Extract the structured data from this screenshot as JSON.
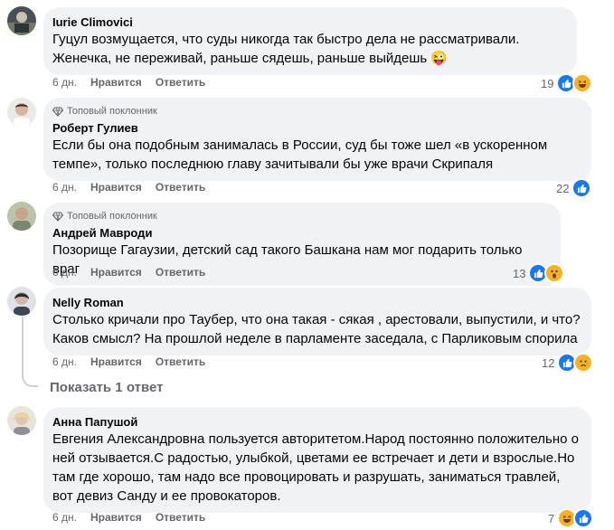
{
  "comments": [
    {
      "author": "Iurie Climovici",
      "badge": "",
      "text": "Гуцул возмущается, что суды никогда так быстро дела не рассматривали. Женечка, не переживай, раньше сядешь, раньше выйдешь 😜",
      "time": "6 дн.",
      "like_label": "Нравится",
      "reply_label": "Ответить",
      "reaction_count": "19",
      "reactions": [
        "like-icon",
        "haha-icon"
      ]
    },
    {
      "author": "Роберт Гулиев",
      "badge": "Топовый поклонник",
      "text": "Если бы она подобным занималась в России, суд бы тоже шел «в ускоренном темпе», только последнюю главу зачитывали бы уже врачи Скрипаля",
      "time": "6 дн.",
      "like_label": "Нравится",
      "reply_label": "Ответить",
      "reaction_count": "22",
      "reactions": [
        "like-icon"
      ]
    },
    {
      "author": "Андрей Мавроди",
      "badge": "Топовый поклонник",
      "text": "Позорище Гагаузии, детский сад такого Башкана нам мог подарить только враг",
      "time": "6 дн.",
      "like_label": "Нравится",
      "reply_label": "Ответить",
      "reaction_count": "13",
      "reactions": [
        "like-icon",
        "wow-icon"
      ]
    },
    {
      "author": "Nelly Roman",
      "badge": "",
      "text": "Столько кричали про Таубер, что она такая - сякая , арестовали, выпустили, и что? Каков смысл? На прошлой неделе в парламенте заседала, с Парликовым спорила",
      "time": "6 дн.",
      "like_label": "Нравится",
      "reply_label": "Ответить",
      "reaction_count": "12",
      "reactions": [
        "like-icon",
        "sad-icon"
      ]
    },
    {
      "author": "Анна Папушой",
      "badge": "",
      "text": "Евгения Александровна пользуется авторитетом.Народ постоянно положительно о ней отзывается.С радостью, улыбкой, цветами ее встречает и дети и взрослые.Но там где хорошо, там надо все провоцировать и разрушать, заниматься травлей, вот девиз Санду и ее провокаторов.",
      "time": "6 дн.",
      "like_label": "Нравится",
      "reply_label": "Ответить",
      "reaction_count": "7",
      "reactions": [
        "haha-icon",
        "like-icon"
      ]
    }
  ],
  "show_replies_label": "Показать 1 ответ",
  "colors": {
    "bubble": "#f0f2f5",
    "meta_text": "#65676b",
    "like_blue": "#1877f2",
    "emoji_yellow": "#f7b125"
  }
}
